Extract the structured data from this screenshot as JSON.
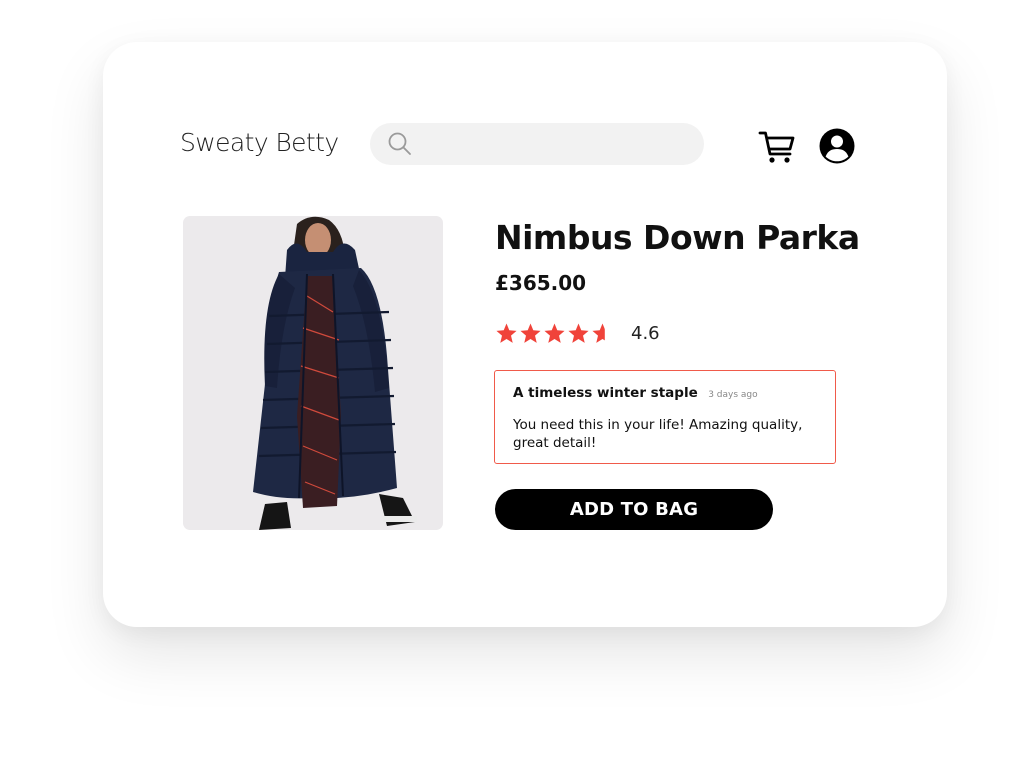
{
  "header": {
    "logo": "Sweaty Betty",
    "search": {
      "placeholder": "",
      "value": "",
      "icon": "search-icon"
    },
    "cart_icon": "cart-icon",
    "account_icon": "user-account-icon"
  },
  "product": {
    "title": "Nimbus Down Parka",
    "price": "£365.00",
    "rating": 4.6,
    "rating_label": "4.6",
    "rating_max": 5,
    "image": "product-photo"
  },
  "review": {
    "title": "A timeless winter staple",
    "time": "3 days ago",
    "body": "You need this in your life! Amazing quality, great detail!"
  },
  "actions": {
    "add_to_bag": "ADD TO BAG"
  },
  "colors": {
    "accent": "#f05a4a",
    "star": "#f0433a",
    "button_bg": "#000000",
    "button_text": "#ffffff",
    "search_bg": "#f2f2f2"
  }
}
